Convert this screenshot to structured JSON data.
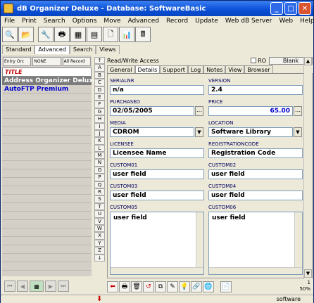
{
  "window": {
    "title": "dB Organizer Deluxe - Database: SoftwareBasic"
  },
  "menu": [
    "File",
    "Print",
    "Search",
    "Options",
    "Move",
    "Advanced",
    "Record",
    "Update",
    "Web dB Server",
    "Web",
    "Help"
  ],
  "mode_tabs": [
    "Standard",
    "Advanced",
    "Search",
    "Views"
  ],
  "left": {
    "buttons": [
      "Entry Orc",
      "NONE",
      "All Record"
    ],
    "list_header": "TITLE",
    "items": [
      "Address Organizer Deluxe",
      "AutoFTP Premium"
    ]
  },
  "alpha": [
    "↑",
    "A",
    "B",
    "C",
    "D",
    "E",
    "F",
    "G",
    "H",
    "I",
    "J",
    "K",
    "L",
    "M",
    "N",
    "O",
    "P",
    "Q",
    "R",
    "S",
    "T",
    "U",
    "V",
    "W",
    "X",
    "Y",
    "Z",
    "↓"
  ],
  "header": {
    "rw_label": "Read/Write Access",
    "ro_label": "RO",
    "blank_button": "Blank"
  },
  "tabs": [
    "General",
    "Details",
    "Support",
    "Log",
    "Notes",
    "View",
    "Browser"
  ],
  "active_tab": "Details",
  "fields": {
    "serialnr": {
      "label": "SERIALNR",
      "value": "n/a"
    },
    "version": {
      "label": "VERSION",
      "value": "2.4"
    },
    "purchased": {
      "label": "PURCHASED",
      "value": "02/05/2005"
    },
    "price": {
      "label": "PRICE",
      "value": "65.00"
    },
    "media": {
      "label": "MEDIA",
      "value": "CDROM"
    },
    "location": {
      "label": "LOCATION",
      "value": "Software Library"
    },
    "licensee": {
      "label": "LICENSEE",
      "value": "Licensee Name"
    },
    "regcode": {
      "label": "REGISTRATIONCODE",
      "value": "Registration Code"
    },
    "custom01": {
      "label": "CUSTOM01",
      "value": "user field"
    },
    "custom02": {
      "label": "CUSTOM02",
      "value": "user field"
    },
    "custom03": {
      "label": "CUSTOM03",
      "value": "user field"
    },
    "custom04": {
      "label": "CUSTOM04",
      "value": "user field"
    },
    "custom05": {
      "label": "CUSTOM05",
      "value": "user field"
    },
    "custom06": {
      "label": "CUSTOM06",
      "value": "user field"
    }
  },
  "record": {
    "num": "1",
    "pct": "50%"
  },
  "status": {
    "db": "software"
  }
}
